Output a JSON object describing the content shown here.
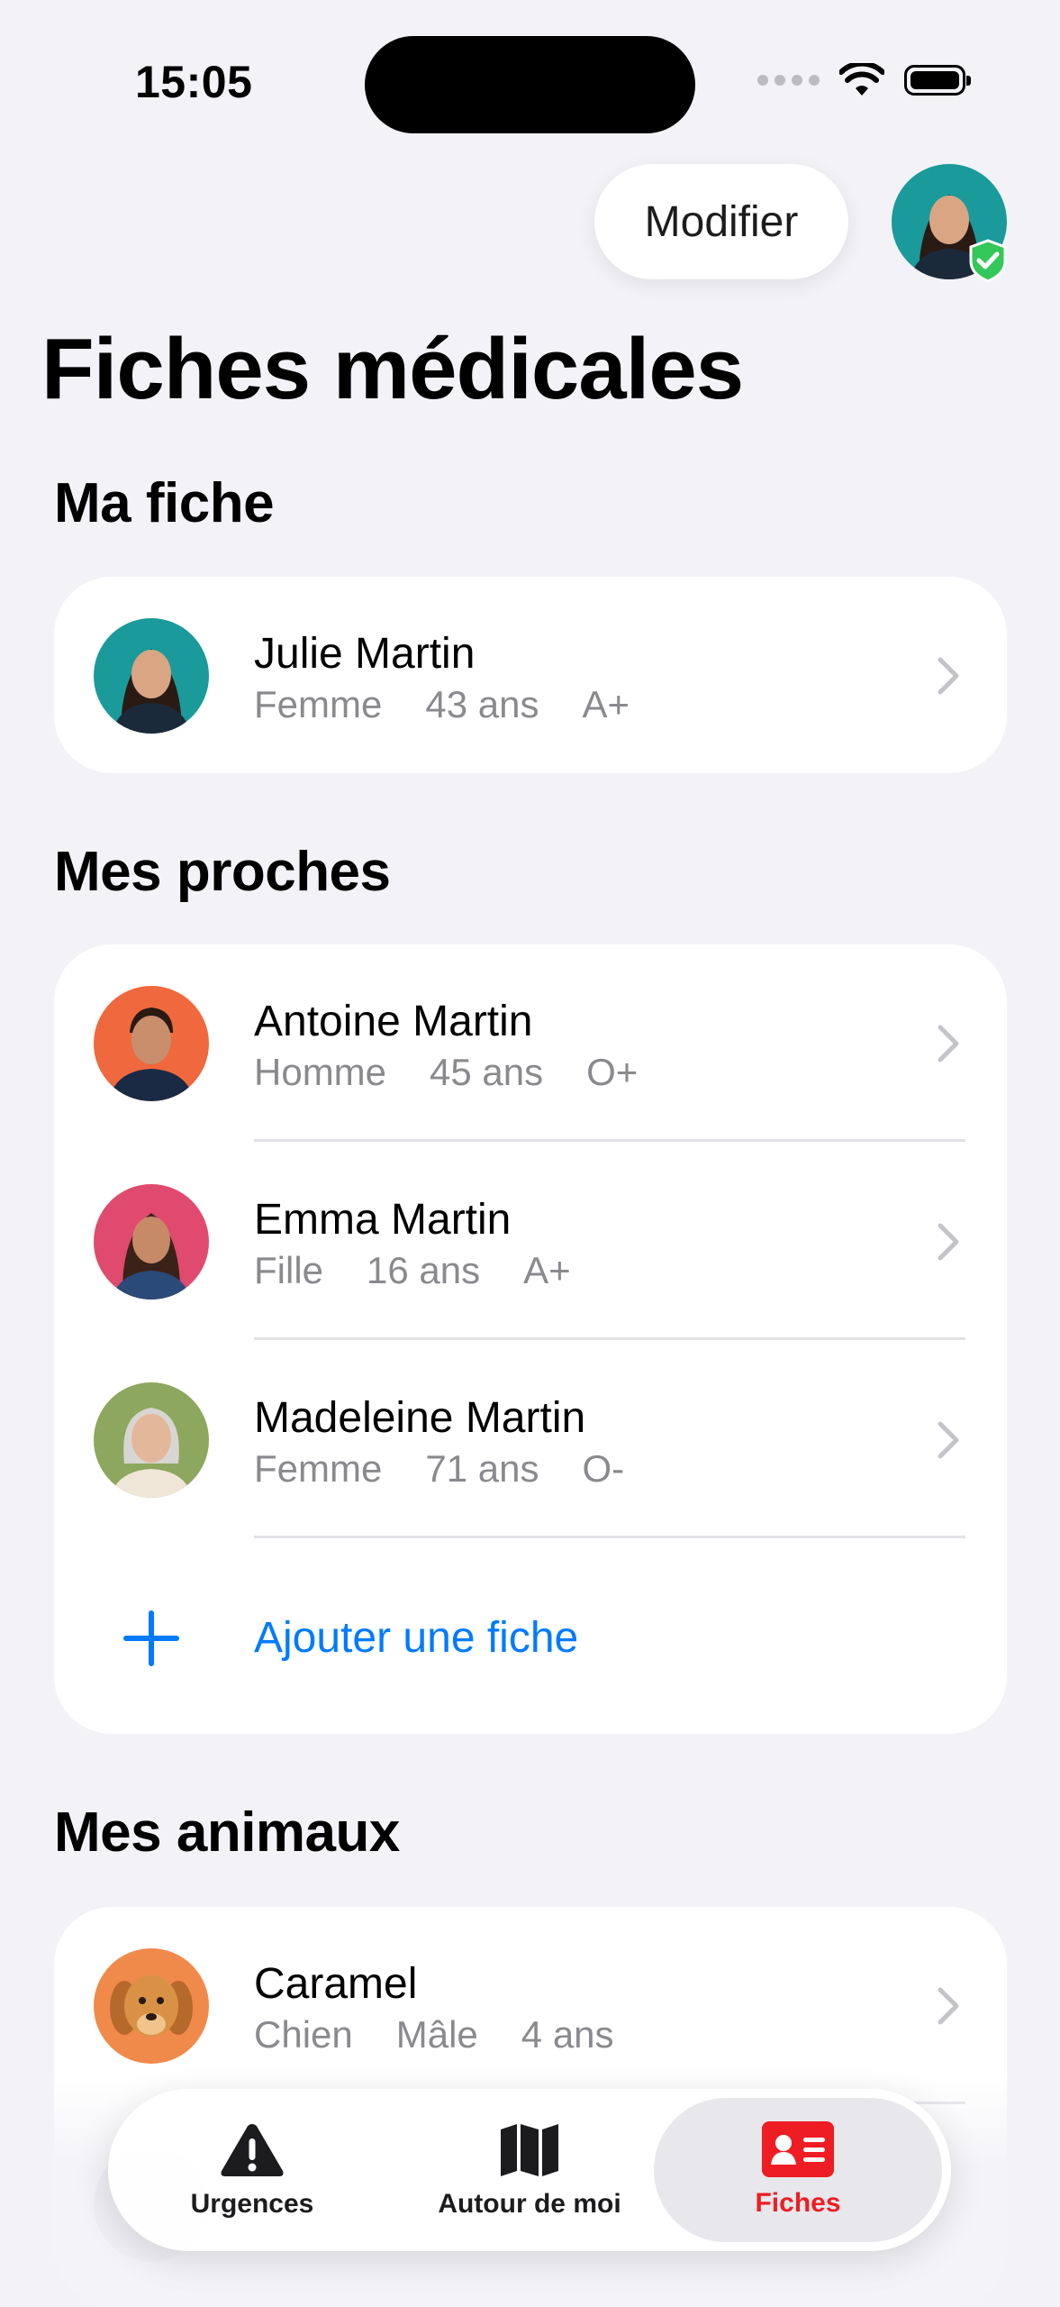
{
  "status_bar": {
    "time": "15:05"
  },
  "header": {
    "edit_label": "Modifier",
    "title": "Fiches médicales"
  },
  "my_record": {
    "section_title": "Ma fiche",
    "person": {
      "name": "Julie Martin",
      "sex": "Femme",
      "age": "43 ans",
      "blood": "A+"
    }
  },
  "relatives": {
    "section_title": "Mes proches",
    "items": [
      {
        "name": "Antoine Martin",
        "sex": "Homme",
        "age": "45 ans",
        "blood": "O+"
      },
      {
        "name": "Emma Martin",
        "sex": "Fille",
        "age": "16 ans",
        "blood": "A+"
      },
      {
        "name": "Madeleine Martin",
        "sex": "Femme",
        "age": "71 ans",
        "blood": "O-"
      }
    ],
    "add_label": "Ajouter une fiche"
  },
  "pets": {
    "section_title": "Mes animaux",
    "items": [
      {
        "name": "Caramel",
        "species": "Chien",
        "sex": "Mâle",
        "age": "4 ans"
      }
    ]
  },
  "tab_bar": {
    "tabs": [
      {
        "label": "Urgences",
        "icon": "warning-icon"
      },
      {
        "label": "Autour de moi",
        "icon": "map-icon"
      },
      {
        "label": "Fiches",
        "icon": "id-card-icon",
        "active": true
      }
    ]
  },
  "colors": {
    "accent": "#007AFF",
    "active_tab": "#EE1D23",
    "background": "#F2F2F7"
  }
}
